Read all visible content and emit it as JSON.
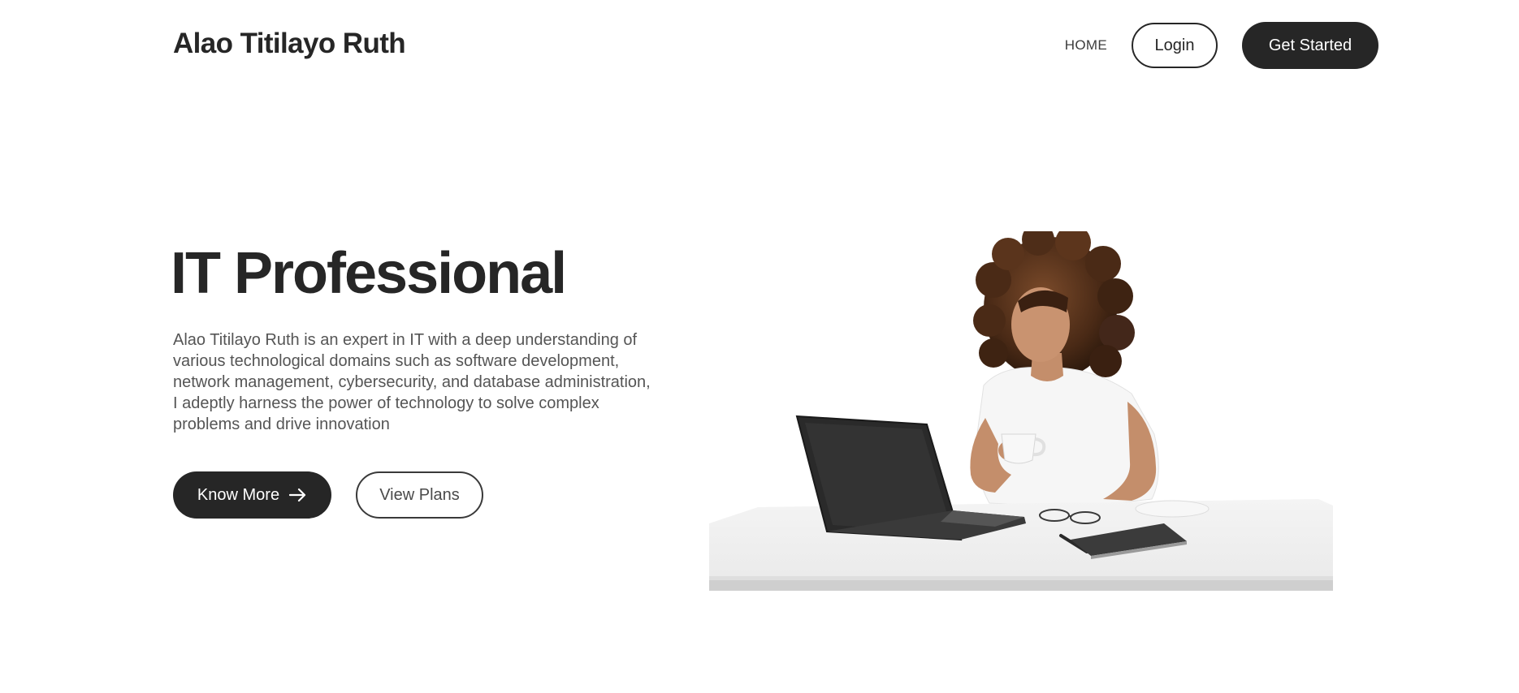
{
  "header": {
    "brand": "Alao Titilayo Ruth",
    "nav": {
      "home_label": "HOME",
      "login_label": "Login",
      "get_started_label": "Get Started"
    }
  },
  "hero": {
    "title": "IT Professional",
    "description": "Alao Titilayo Ruth is an expert in IT with a deep understanding of various technological domains such as software development, network management, cybersecurity, and database administration, I adeptly harness the power of technology to solve complex problems and drive innovation",
    "know_more_label": "Know More",
    "know_more_icon": "arrow-right-icon",
    "view_plans_label": "View Plans",
    "image": "woman-at-laptop-illustration"
  },
  "colors": {
    "primary_dark": "#262626",
    "text_muted": "#555555",
    "background": "#ffffff"
  }
}
